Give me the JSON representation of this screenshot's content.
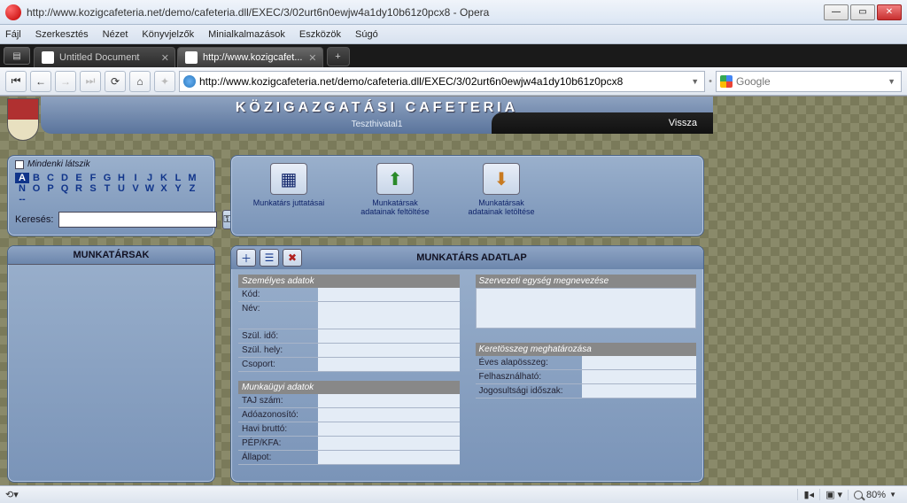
{
  "window": {
    "title": "http://www.kozigcafeteria.net/demo/cafeteria.dll/EXEC/3/02urt6n0ewjw4a1dy10b61z0pcx8 - Opera"
  },
  "menus": [
    "Fájl",
    "Szerkesztés",
    "Nézet",
    "Könyvjelzők",
    "Minialkalmazások",
    "Eszközök",
    "Súgó"
  ],
  "tabs": [
    {
      "label": "Untitled Document",
      "active": false
    },
    {
      "label": "http://www.kozigcafet...",
      "active": true
    }
  ],
  "address": {
    "url": "http://www.kozigcafeteria.net/demo/cafeteria.dll/EXEC/3/02urt6n0ewjw4a1dy10b61z0pcx8"
  },
  "search": {
    "placeholder": "Google"
  },
  "banner": {
    "title": "KÖZIGAZGATÁSI CAFETERIA",
    "subtitle": "Teszthivatal1",
    "back": "Vissza"
  },
  "filter": {
    "header": "Mindenki látszik",
    "letters": [
      "A",
      "B",
      "C",
      "D",
      "E",
      "F",
      "G",
      "H",
      "I",
      "J",
      "K",
      "L",
      "M",
      "N",
      "O",
      "P",
      "Q",
      "R",
      "S",
      "T",
      "U",
      "V",
      "W",
      "X",
      "Y",
      "Z",
      "--"
    ],
    "selected": "A",
    "search_label": "Keresés:"
  },
  "tools": [
    {
      "label": "Munkatárs juttatásai"
    },
    {
      "label": "Munkatársak adatainak feltöltése"
    },
    {
      "label": "Munkatársak adatainak letöltése"
    }
  ],
  "list": {
    "header": "MUNKATÁRSAK"
  },
  "detail": {
    "header": "MUNKATÁRS ADATLAP",
    "sections": {
      "personal": {
        "title": "Személyes adatok",
        "fields": {
          "kod": "Kód:",
          "nev": "Név:",
          "szulido": "Szül. idő:",
          "szulhely": "Szül. hely:",
          "csoport": "Csoport:"
        }
      },
      "work": {
        "title": "Munkaügyi adatok",
        "fields": {
          "taj": "TAJ szám:",
          "ado": "Adóazonosító:",
          "brutto": "Havi bruttó:",
          "pep": "PÉP/KFA:",
          "allapot": "Állapot:"
        }
      },
      "org": {
        "title": "Szervezeti egység megnevezése"
      },
      "budget": {
        "title": "Keretösszeg meghatározása",
        "fields": {
          "eves": "Éves alapösszeg:",
          "felh": "Felhasználható:",
          "jog": "Jogosultsági időszak:"
        }
      }
    }
  },
  "status": {
    "zoom": "80%"
  }
}
